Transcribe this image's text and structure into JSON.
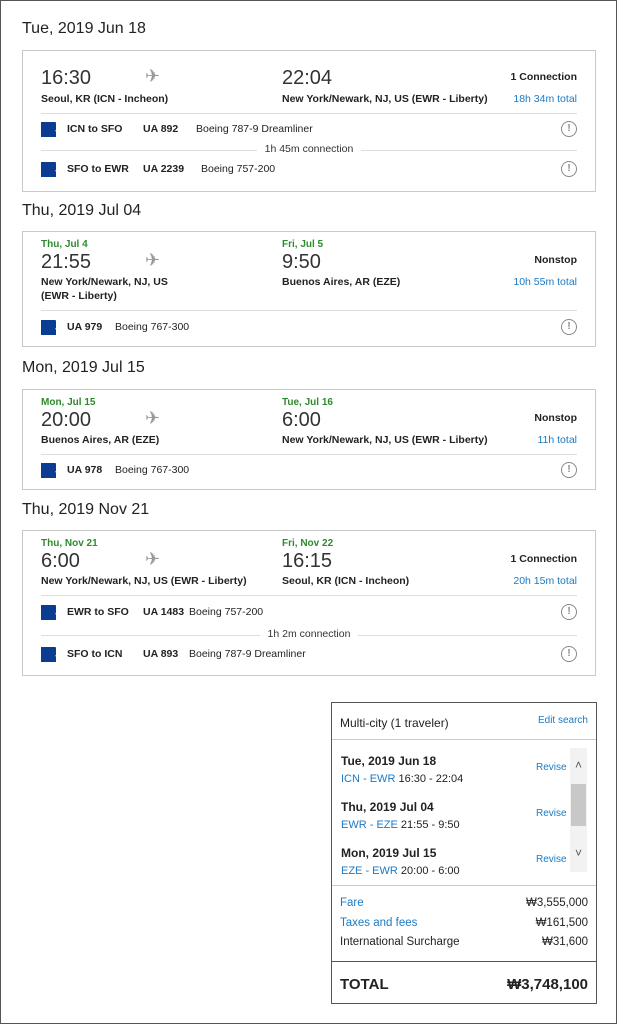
{
  "trips": [
    {
      "date": "Tue, 2019 Jun 18",
      "dep_date": "",
      "arr_date": "",
      "dep_time": "16:30",
      "arr_time": "22:04",
      "dep_place": "Seoul, KR (ICN - Incheon)",
      "arr_place": "New York/Newark, NJ, US (EWR - Liberty)",
      "connections": "1 Connection",
      "duration": "18h 34m total",
      "segments": [
        {
          "route": "ICN to SFO",
          "flight": "UA 892",
          "aircraft": "Boeing 787-9 Dreamliner"
        },
        {
          "route": "SFO to EWR",
          "flight": "UA 2239",
          "aircraft": "Boeing 757-200"
        }
      ],
      "connection_text": "1h 45m connection"
    },
    {
      "date": "Thu, 2019 Jul 04",
      "dep_date": "Thu, Jul 4",
      "arr_date": "Fri, Jul 5",
      "dep_time": "21:55",
      "arr_time": "9:50",
      "dep_place_1": "New York/Newark, NJ, US",
      "dep_place_2": "(EWR - Liberty)",
      "arr_place": "Buenos Aires, AR (EZE)",
      "connections": "Nonstop",
      "duration": "10h 55m total",
      "segments": [
        {
          "route": "",
          "flight": "UA 979",
          "aircraft": "Boeing 767-300"
        }
      ]
    },
    {
      "date": "Mon, 2019 Jul 15",
      "dep_date": "Mon, Jul 15",
      "arr_date": "Tue, Jul 16",
      "dep_time": "20:00",
      "arr_time": "6:00",
      "dep_place": "Buenos Aires, AR (EZE)",
      "arr_place": "New York/Newark, NJ, US (EWR - Liberty)",
      "connections": "Nonstop",
      "duration": "11h total",
      "segments": [
        {
          "route": "",
          "flight": "UA 978",
          "aircraft": "Boeing 767-300"
        }
      ]
    },
    {
      "date": "Thu, 2019 Nov 21",
      "dep_date": "Thu, Nov 21",
      "arr_date": "Fri, Nov 22",
      "dep_time": "6:00",
      "arr_time": "16:15",
      "dep_place": "New York/Newark, NJ, US (EWR - Liberty)",
      "arr_place": "Seoul, KR (ICN -  Incheon)",
      "connections": "1 Connection",
      "duration": "20h 15m total",
      "segments": [
        {
          "route": "EWR to SFO",
          "flight": "UA 1483",
          "aircraft": "Boeing 757-200"
        },
        {
          "route": "SFO to ICN",
          "flight": "UA 893",
          "aircraft": "Boeing 787-9 Dreamliner"
        }
      ],
      "connection_text": "1h 2m connection"
    }
  ],
  "summary": {
    "title": "Multi-city (1 traveler)",
    "edit": "Edit search",
    "revise": "Revise",
    "items": [
      {
        "date": "Tue, 2019 Jun 18",
        "route": "ICN - EWR",
        "times": "16:30 - 22:04"
      },
      {
        "date": "Thu, 2019 Jul 04",
        "route": "EWR - EZE",
        "times": "21:55 - 9:50"
      },
      {
        "date": "Mon, 2019 Jul 15",
        "route": "EZE - EWR",
        "times": "20:00 - 6:00"
      }
    ],
    "fare_label": "Fare",
    "fare": "₩3,555,000",
    "taxes_label": "Taxes and fees",
    "taxes": "₩161,500",
    "surcharge_label": "International Surcharge",
    "surcharge": "₩31,600",
    "total_label": "TOTAL",
    "total": "₩3,748,100"
  },
  "icons": {
    "plane": "plane-icon",
    "info": "info-icon",
    "airline": "united-logo-icon"
  }
}
